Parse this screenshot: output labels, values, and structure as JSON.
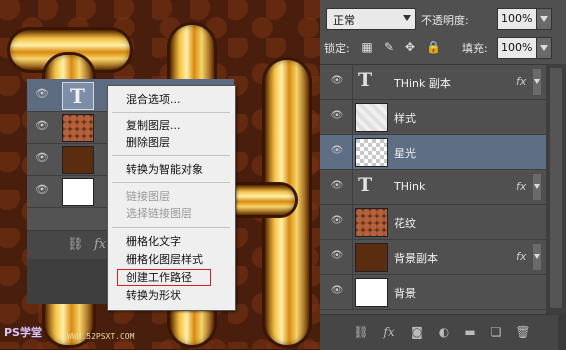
{
  "canvas": {
    "letters": [
      "T",
      "H"
    ],
    "watermark_left": "PS学堂",
    "watermark_mid": "WWW.52PSXT.COM"
  },
  "left_panel": {
    "rows": [
      {
        "visible": true,
        "thumb": "text",
        "label": "T"
      },
      {
        "visible": true,
        "thumb": "pattern"
      },
      {
        "visible": true,
        "thumb": "brown"
      },
      {
        "visible": true,
        "thumb": "white"
      }
    ],
    "footer_icons": [
      "link-icon",
      "fx-icon"
    ]
  },
  "context_menu": {
    "groups": [
      [
        {
          "label": "混合选项...",
          "enabled": true
        }
      ],
      [
        {
          "label": "复制图层...",
          "enabled": true
        },
        {
          "label": "删除图层",
          "enabled": true
        }
      ],
      [
        {
          "label": "转换为智能对象",
          "enabled": true
        }
      ],
      [
        {
          "label": "链接图层",
          "enabled": false
        },
        {
          "label": "选择链接图层",
          "enabled": false
        }
      ],
      [
        {
          "label": "栅格化文字",
          "enabled": true
        },
        {
          "label": "栅格化图层样式",
          "enabled": true
        },
        {
          "label": "创建工作路径",
          "enabled": true,
          "highlighted": true
        },
        {
          "label": "转换为形状",
          "enabled": true
        }
      ]
    ]
  },
  "layers_panel": {
    "blend_mode": "正常",
    "opacity_label": "不透明度:",
    "opacity_value": "100%",
    "lock_label": "锁定:",
    "fill_label": "填充:",
    "fill_value": "100%",
    "lock_icons": [
      "lock-transparent-icon",
      "lock-paint-icon",
      "lock-move-icon",
      "lock-all-icon"
    ],
    "layers": [
      {
        "name": "THink 副本",
        "thumb": "text",
        "fx": "fx",
        "selected": false
      },
      {
        "name": "样式",
        "thumb": "text-glow",
        "fx": "",
        "selected": false
      },
      {
        "name": "星光",
        "thumb": "checker",
        "fx": "",
        "selected": true
      },
      {
        "name": "THink",
        "thumb": "text",
        "fx": "fx",
        "selected": false
      },
      {
        "name": "花纹",
        "thumb": "pattern",
        "fx": "",
        "selected": false
      },
      {
        "name": "背景副本",
        "thumb": "brown",
        "fx": "fx",
        "selected": false
      },
      {
        "name": "背景",
        "thumb": "white",
        "fx": "",
        "selected": false
      }
    ],
    "thumb_text_glyph": "T",
    "footer_icons": [
      "link-layers-icon",
      "fx-icon",
      "mask-icon",
      "adjustment-icon",
      "group-icon",
      "new-layer-icon",
      "trash-icon"
    ],
    "fx_label": "fx"
  }
}
